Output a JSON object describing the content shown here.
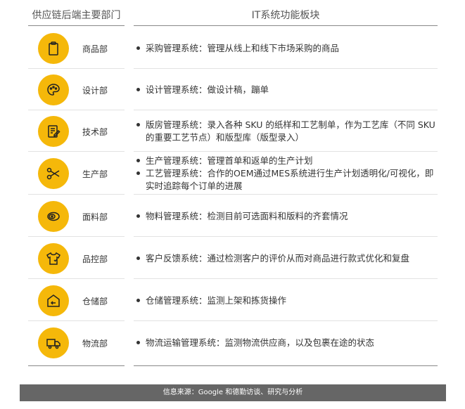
{
  "header": {
    "left": "供应链后端主要部门",
    "right": "IT系统功能板块"
  },
  "rows": [
    {
      "dept": "商品部",
      "icon": "clipboard-icon",
      "lines": [
        "采购管理系统：管理从线上和线下市场采购的商品"
      ]
    },
    {
      "dept": "设计部",
      "icon": "palette-icon",
      "lines": [
        "设计管理系统：做设计稿，蹦单"
      ]
    },
    {
      "dept": "技术部",
      "icon": "document-edit-icon",
      "lines": [
        "版房管理系统：录入各种 SKU 的纸样和工艺制单，作为工艺库（不同 SKU 的重要工艺节点）和版型库（版型录入）"
      ]
    },
    {
      "dept": "生产部",
      "icon": "scissors-icon",
      "lines": [
        "生产管理系统：管理首单和返单的生产计划",
        "工艺管理系统：合作的OEM通过MES系统进行生产计划透明化/可视化，即实时追踪每个订单的进展"
      ]
    },
    {
      "dept": "面料部",
      "icon": "fabric-roll-icon",
      "lines": [
        "物料管理系统：检测目前可选面料和版料的齐套情况"
      ]
    },
    {
      "dept": "品控部",
      "icon": "shirt-icon",
      "lines": [
        "客户反馈系统：通过检测客户的评价从而对商品进行款式优化和复盘"
      ]
    },
    {
      "dept": "仓储部",
      "icon": "warehouse-icon",
      "lines": [
        "仓储管理系统：监测上架和拣货操作"
      ]
    },
    {
      "dept": "物流部",
      "icon": "truck-icon",
      "lines": [
        "物流运输管理系统：监测物流供应商，以及包裹在途的状态"
      ]
    }
  ],
  "footer": "信息来源：Google 和德勤访谈、研究与分析",
  "colors": {
    "accent": "#f5b80a",
    "footer_bg": "#666666"
  }
}
